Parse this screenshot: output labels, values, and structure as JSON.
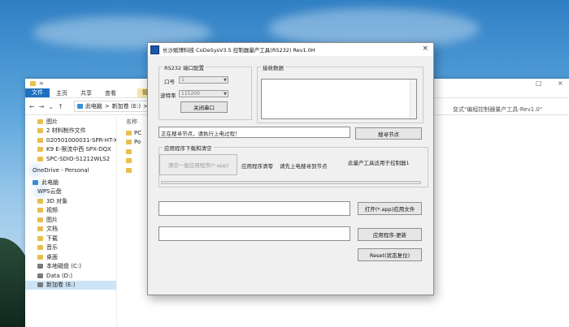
{
  "explorer": {
    "title_parts": [
      "",
      "="
    ],
    "manage_label": "管理",
    "ribbon_tabs": [
      "文件",
      "主页",
      "共享",
      "查看"
    ],
    "nav_icons": [
      "back-arrow-icon",
      "forward-arrow-icon",
      "chevron-down-icon",
      "up-arrow-icon"
    ],
    "address": [
      "此电脑",
      ">",
      "新加卷 (E:)",
      ">"
    ],
    "address_right": "变式\"编程控制器量产工具-Rev1.0\"",
    "sidebar": [
      {
        "label": "图片",
        "icon": "folder-icon"
      },
      {
        "label": "2 材料制作文件",
        "icon": "folder-icon"
      },
      {
        "label": "020501000031-SPR-HT-X",
        "icon": "folder-icon"
      },
      {
        "label": "K9 E-限流中西 SPX-DQX",
        "icon": "folder-icon"
      },
      {
        "label": "SPC-SDIO-S1212WLS2",
        "icon": "folder-icon"
      }
    ],
    "onedrive": "OneDrive - Personal",
    "this_pc": "此电脑",
    "pc_items": [
      {
        "label": "WPS云盘",
        "icon": "cloud-icon"
      },
      {
        "label": "3D 对象",
        "icon": "folder-icon"
      },
      {
        "label": "视频",
        "icon": "folder-icon"
      },
      {
        "label": "图片",
        "icon": "folder-icon"
      },
      {
        "label": "文档",
        "icon": "folder-icon"
      },
      {
        "label": "下载",
        "icon": "folder-icon"
      },
      {
        "label": "音乐",
        "icon": "folder-icon"
      },
      {
        "label": "桌面",
        "icon": "folder-icon"
      },
      {
        "label": "本地磁盘 (C:)",
        "icon": "drive-icon"
      },
      {
        "label": "Data (D:)",
        "icon": "drive-icon"
      },
      {
        "label": "新加卷 (E:)",
        "icon": "drive-icon"
      }
    ],
    "list_header": "名称",
    "list_items": [
      "PC",
      "Po",
      "",
      "",
      ""
    ]
  },
  "dialog": {
    "title": "长沙赋博科技 CoDeSysV3.5 控制器量产工具(RS232) Rev1.0H",
    "close": "×",
    "serial_group": "RS232 端口配置",
    "port_label": "口号",
    "port_value": "1",
    "baud_label": "波特率",
    "baud_value": "115200",
    "close_port_button": "关闭串口",
    "recv_group": "接收数据",
    "status_text": "正在搜寻节点，请执行上电过程！",
    "search_button": "搜寻节点",
    "download_group": "应用程序下载和清空",
    "clear_button": "清空一般应用程序(*.app)",
    "clear_note": "应用程序清零",
    "first_hint": "请先上电搜寻到节点",
    "right_hint": "此量产工具适用于控制器1",
    "open_app_button": "打开(*.app)应用文件",
    "update_button": "应用程序-更新",
    "reset_button": "Reset(状态复位)",
    "progress_value": 0
  }
}
